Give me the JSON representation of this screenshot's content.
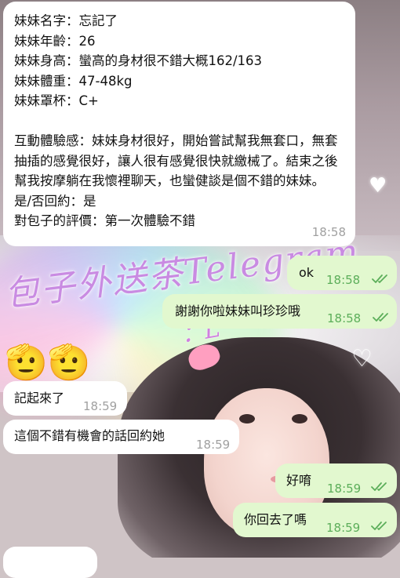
{
  "watermark": {
    "line1": "包子外送茶Telegram",
    "line2": "：L"
  },
  "messages": [
    {
      "id": "profile",
      "direction": "incoming",
      "text": "妹妹名字：忘記了\n妹妹年齡：26\n妹妹身高：蠻高的身材很不錯大概162/163\n妹妹體重：47-48kg\n妹妹罩杯：C+\n\n互動體驗感：妹妹身材很好，開始嘗試幫我無套口，無套抽插的感覺很好，讓人很有感覺很快就繳械了。結束之後幫我按摩躺在我懷裡聊天，也蠻健談是個不錯的妹妹。\n是/否回約：是\n對包子的評價：第一次體驗不錯",
      "time": "18:58"
    },
    {
      "id": "ok",
      "direction": "outgoing",
      "text": "ok",
      "time": "18:58",
      "status": "read"
    },
    {
      "id": "thanks",
      "direction": "outgoing",
      "text": "謝謝你啦妹妹叫珍珍哦",
      "time": "18:58",
      "status": "read"
    },
    {
      "id": "emoji",
      "direction": "incoming",
      "text": "🫡🫡"
    },
    {
      "id": "remember",
      "direction": "incoming",
      "text": "記起來了",
      "time": "18:59"
    },
    {
      "id": "goodchance",
      "direction": "incoming",
      "text": "這個不錯有機會的話回約她",
      "time": "18:59"
    },
    {
      "id": "ok2",
      "direction": "outgoing",
      "text": "好唷",
      "time": "18:59",
      "status": "read"
    },
    {
      "id": "backyet",
      "direction": "outgoing",
      "text": "你回去了嗎",
      "time": "18:59",
      "status": "read"
    }
  ],
  "colors": {
    "incoming_bubble": "#ffffff",
    "outgoing_bubble": "#e2f8cf",
    "outgoing_time": "#5cae5a",
    "incoming_time": "#a0a0a0",
    "watermark": "#c98be2"
  },
  "icons": {
    "read_receipt": "double-check-icon"
  }
}
